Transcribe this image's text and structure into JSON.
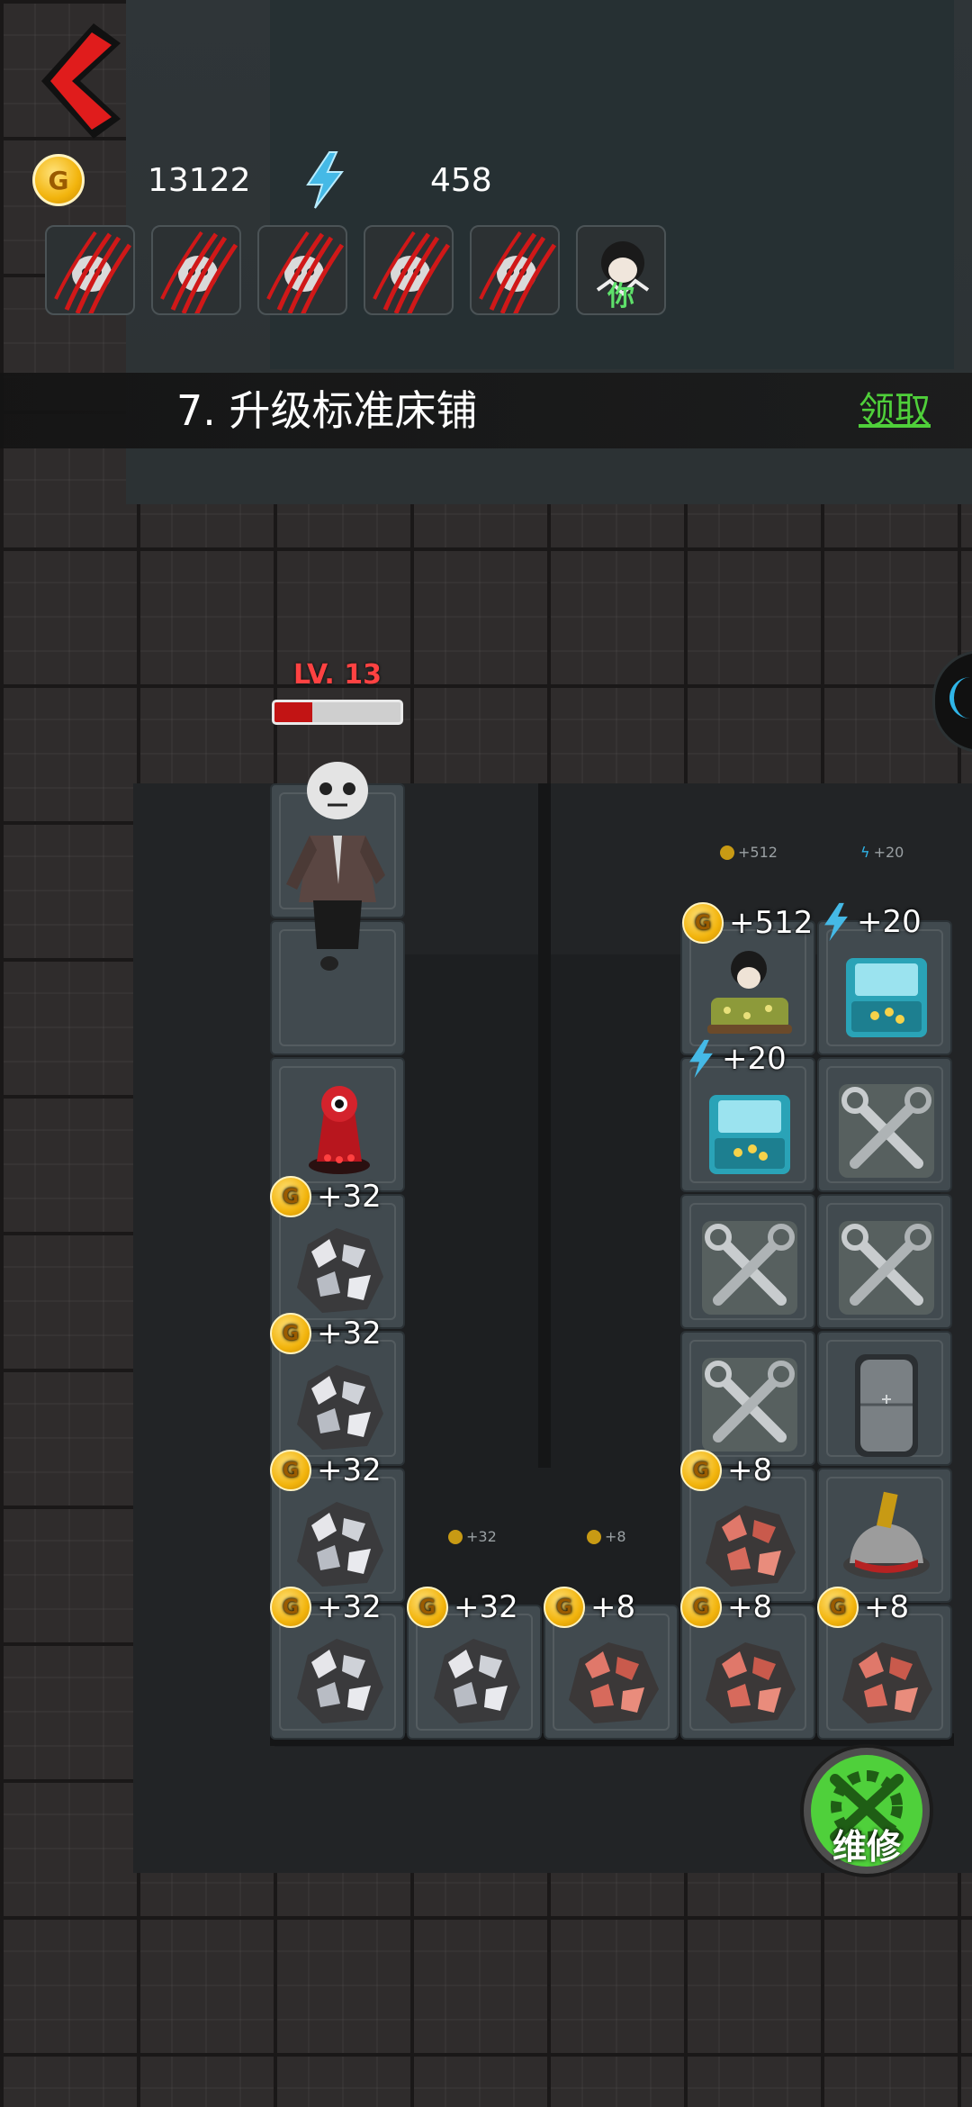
{
  "hud": {
    "coins": "13122",
    "energy": "458",
    "coin_icon": "gold-coin-icon",
    "energy_icon": "lightning-icon",
    "back_icon": "back-arrow-icon"
  },
  "avatar_slots": [
    {
      "icon": "claw-scratch-ghost-icon"
    },
    {
      "icon": "claw-scratch-ghost-icon"
    },
    {
      "icon": "claw-scratch-ghost-icon"
    },
    {
      "icon": "claw-scratch-ghost-icon"
    },
    {
      "icon": "claw-scratch-ghost-icon"
    },
    {
      "icon": "player-avatar-icon",
      "label": "你"
    }
  ],
  "task": {
    "text": "7. 升级标准床铺",
    "claim": "领取"
  },
  "enemy": {
    "level": "LV. 13",
    "hp_fraction": 0.3
  },
  "yields": {
    "bed": "+512",
    "arcade_top": "+20",
    "arcade_mid": "+20",
    "ore_silver": "+32",
    "ore_red": "+8"
  },
  "ghost_labels": {
    "bed": "+512",
    "arcade": "+20",
    "silver": "+32",
    "red": "+8"
  },
  "repair": {
    "label": "维修",
    "icon": "wrench-gear-icon"
  },
  "colors": {
    "accent_green": "#4fcf3a",
    "hp_red": "#c21414",
    "energy_blue": "#2fb5e8",
    "coin_gold": "#f2b40d"
  }
}
